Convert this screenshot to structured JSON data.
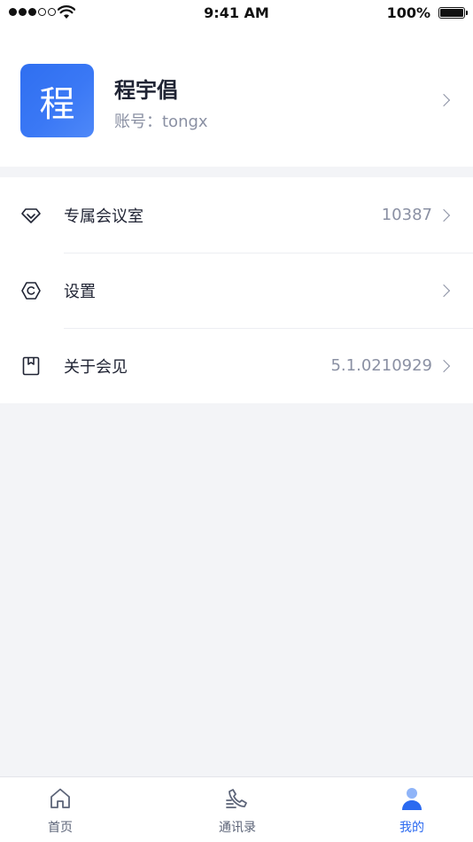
{
  "status_bar": {
    "time": "9:41 AM",
    "battery": "100%"
  },
  "profile": {
    "avatar_char": "程",
    "name": "程宇倡",
    "account": "账号：tongx"
  },
  "menu": {
    "items": [
      {
        "label": "专属会议室",
        "value": "10387",
        "icon": "diamond-icon"
      },
      {
        "label": "设置",
        "value": "",
        "icon": "hexagon-settings-icon"
      },
      {
        "label": "关于会见",
        "value": "5.1.0210929",
        "icon": "bookmark-icon"
      }
    ]
  },
  "tab_bar": {
    "tabs": [
      {
        "label": "首页",
        "icon": "home-icon",
        "active": false
      },
      {
        "label": "通讯录",
        "icon": "phone-icon",
        "active": false
      },
      {
        "label": "我的",
        "icon": "user-icon",
        "active": true
      }
    ]
  },
  "colors": {
    "accent": "#2b6af0",
    "text_primary": "#1f2333",
    "text_secondary": "#8a90a3",
    "background": "#f3f4f7"
  }
}
